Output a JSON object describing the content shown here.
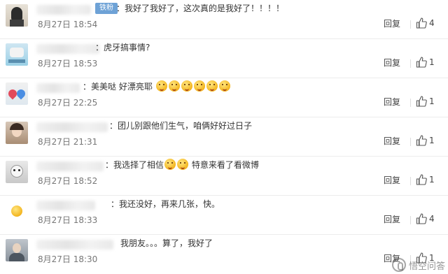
{
  "comments": [
    {
      "badge": "铁粉",
      "text": "：我好了我好了，这次真的是我好了！！！！",
      "emojis": 0,
      "time": "8月27日 18:54",
      "reply": "回复",
      "likes": "4"
    },
    {
      "badge": "",
      "text": "：虎牙搞事情?",
      "emojis": 0,
      "time": "8月27日 18:53",
      "reply": "回复",
      "likes": "1"
    },
    {
      "badge": "",
      "text": "：美美哒  好漂亮耶",
      "emojis": 6,
      "time": "8月27日 22:25",
      "reply": "回复",
      "likes": "1"
    },
    {
      "badge": "",
      "text": "：团儿别跟他们生气，咱俩好好过日子",
      "emojis": 0,
      "time": "8月27日 21:31",
      "reply": "回复",
      "likes": "1"
    },
    {
      "badge": "",
      "text": "：我选择了相信",
      "emojis": 2,
      "text2": "  特意来看了看微博",
      "time": "8月27日 18:52",
      "reply": "回复",
      "likes": "1"
    },
    {
      "badge": "",
      "text": "：我还没好，再来几张，快。",
      "emojis": 0,
      "time": "8月27日 18:33",
      "reply": "回复",
      "likes": "4"
    },
    {
      "badge": "",
      "text": "我朋友。。。算了，我好了",
      "emojis": 0,
      "time": "8月27日 18:30",
      "reply": "回复",
      "likes": "1"
    }
  ],
  "watermark": "悟空问答",
  "colors": {
    "badge": "#6ea2d6",
    "text": "#333333",
    "meta": "#777777"
  }
}
